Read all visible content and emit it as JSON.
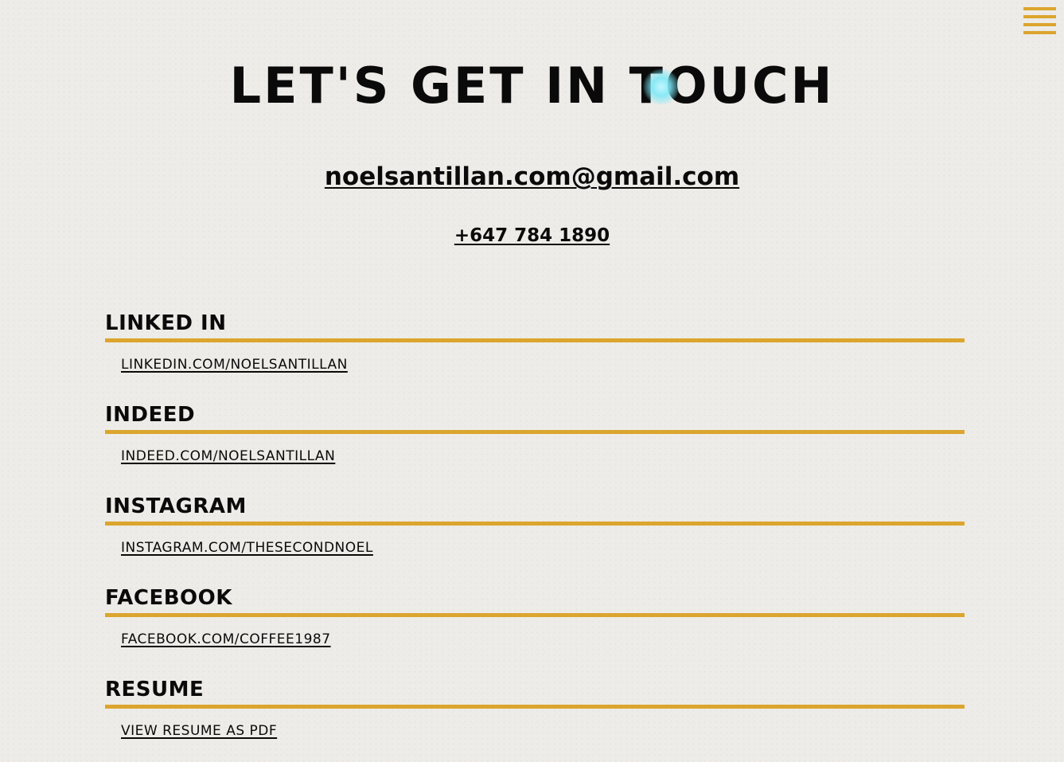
{
  "header": {
    "menu_icon": "hamburger-menu-icon",
    "title": "LET'S GET IN TOUCH"
  },
  "contact": {
    "email": "noelsantillan.com@gmail.com",
    "phone": "+647 784 1890"
  },
  "sections": [
    {
      "heading": "LINKED IN",
      "link": "LINKEDIN.COM/NOELSANTILLAN"
    },
    {
      "heading": "INDEED",
      "link": "INDEED.COM/NOELSANTILLAN"
    },
    {
      "heading": "INSTAGRAM",
      "link": "INSTAGRAM.COM/THESECONDNOEL"
    },
    {
      "heading": "FACEBOOK",
      "link": "FACEBOOK.COM/COFFEE1987"
    },
    {
      "heading": "RESUME",
      "link": "VIEW RESUME AS PDF"
    }
  ],
  "colors": {
    "background": "#eeece8",
    "accent": "#dba52e",
    "text": "#0a0a0a",
    "cursor_glow": "#78e8f8"
  }
}
